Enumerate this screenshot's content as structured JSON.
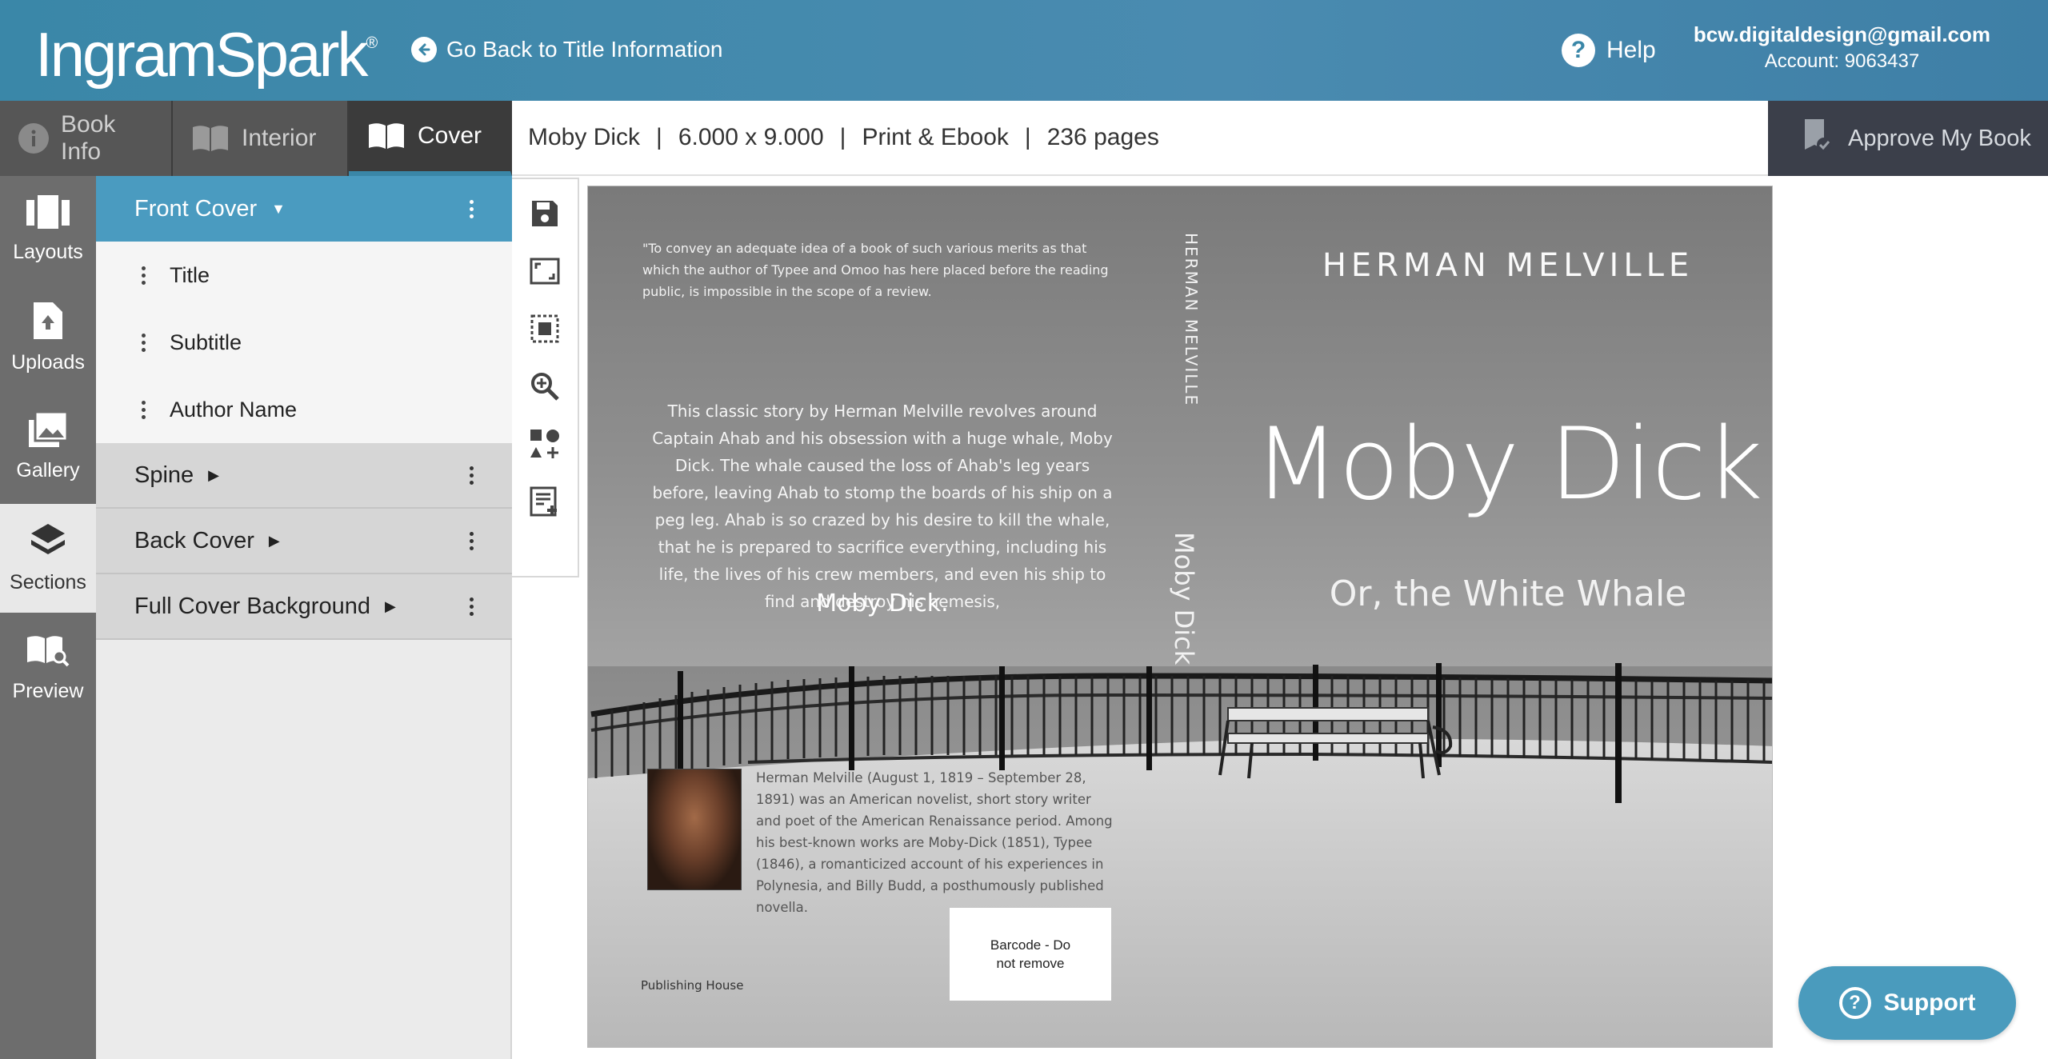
{
  "header": {
    "logo_text": "IngramSpark",
    "logo_mark": "®",
    "back_link": "Go Back to Title Information",
    "help_label": "Help",
    "account_email": "bcw.digitaldesign@gmail.com",
    "account_number": "Account: 9063437"
  },
  "tabs": [
    {
      "label": "Book Info",
      "icon": "info-icon"
    },
    {
      "label": "Interior",
      "icon": "open-book-icon"
    },
    {
      "label": "Cover",
      "icon": "book-cover-icon"
    }
  ],
  "infobar": {
    "title": "Moby Dick",
    "sep": "|",
    "trim_size": "6.000 x 9.000",
    "format": "Print & Ebook",
    "pages": "236 pages"
  },
  "approve_label": "Approve My Book",
  "rail": [
    {
      "label": "Layouts",
      "icon": "layouts-icon"
    },
    {
      "label": "Uploads",
      "icon": "upload-icon"
    },
    {
      "label": "Gallery",
      "icon": "gallery-icon"
    },
    {
      "label": "Sections",
      "icon": "layers-icon"
    },
    {
      "label": "Preview",
      "icon": "preview-book-icon"
    }
  ],
  "sections": {
    "front_cover": "Front Cover",
    "front_items": [
      "Title",
      "Subtitle",
      "Author Name"
    ],
    "spine": "Spine",
    "back_cover": "Back Cover",
    "full_background": "Full Cover Background"
  },
  "tools": [
    "save-icon",
    "fit-screen-icon",
    "select-area-icon",
    "zoom-in-icon",
    "add-shapes-icon",
    "add-text-block-icon"
  ],
  "cover": {
    "quote": "\"To convey an adequate idea of a book of such various merits as that which the author of Typee and Omoo has here placed before the reading public, is impossible in the scope of a review.",
    "blurb": "This classic story by Herman Melville revolves around Captain Ahab and his obsession with a huge whale, Moby Dick. The whale caused the loss of Ahab's leg years before, leaving Ahab to stomp the boards of his ship on a peg leg. Ahab is so crazed by his desire to kill the whale, that he is prepared to sacrifice everything, including his life, the lives of his crew members, and even his ship to find and destroy his nemesis,",
    "blurb_title": "Moby Dick.",
    "spine_author": "HERMAN MELVILLE",
    "spine_title": "Moby Dick",
    "front_author": "HERMAN MELVILLE",
    "front_title": "Moby Dick",
    "front_subtitle": "Or, the White Whale",
    "bio": "Herman Melville (August 1, 1819 – September 28, 1891) was an American novelist, short story writer and poet of the American Renaissance period. Among his best-known works are Moby-Dick (1851), Typee (1846), a romanticized account of his experiences in Polynesia, and Billy Budd, a posthumously published novella.",
    "barcode": "Barcode - Do not remove",
    "publisher": "Publishing House"
  },
  "support_label": "Support",
  "colors": {
    "header": "#3a87a8",
    "accent": "#4a9bc0",
    "approve_bg": "#3b3f4a",
    "rail_bg": "#6d6d6d"
  }
}
